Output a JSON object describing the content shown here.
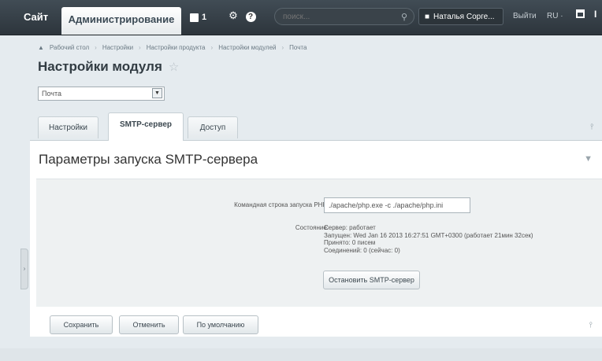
{
  "topbar": {
    "site_tab": "Сайт",
    "admin_tab": "Администрирование",
    "notifications_count": "1",
    "search_placeholder": "поиск...",
    "user_name": "Наталья Сорге...",
    "logout": "Выйти",
    "lang": "RU ·"
  },
  "breadcrumb": [
    "Рабочий стол",
    "Настройки",
    "Настройки продукта",
    "Настройки модулей",
    "Почта"
  ],
  "page": {
    "title": "Настройки модуля",
    "site_select_value": "Почта"
  },
  "tabs": [
    {
      "label": "Настройки",
      "active": false
    },
    {
      "label": "SMTP-сервер",
      "active": true
    },
    {
      "label": "Доступ",
      "active": false
    }
  ],
  "panel": {
    "title": "Параметры запуска SMTP-сервера",
    "cmd_label": "Командная строка запуска PHP:",
    "cmd_value": "./apache/php.exe -c ./apache/php.ini",
    "status_label": "Состояние:",
    "status_lines": [
      "Сервер: работает",
      "Запущен: Wed Jan 16 2013 16:27:51 GMT+0300 (работает 21мин 32сек)",
      "Принято: 0 писем",
      "Соединений: 0 (сейчас: 0)"
    ],
    "stop_button": "Остановить SMTP-сервер"
  },
  "footer": {
    "save": "Сохранить",
    "cancel": "Отменить",
    "default": "По умолчанию"
  },
  "colors": {
    "topbar": "#2d353c",
    "page_bg": "#e5ebef",
    "panel_bg": "#ffffff",
    "panel_body_bg": "#eef1f2"
  }
}
